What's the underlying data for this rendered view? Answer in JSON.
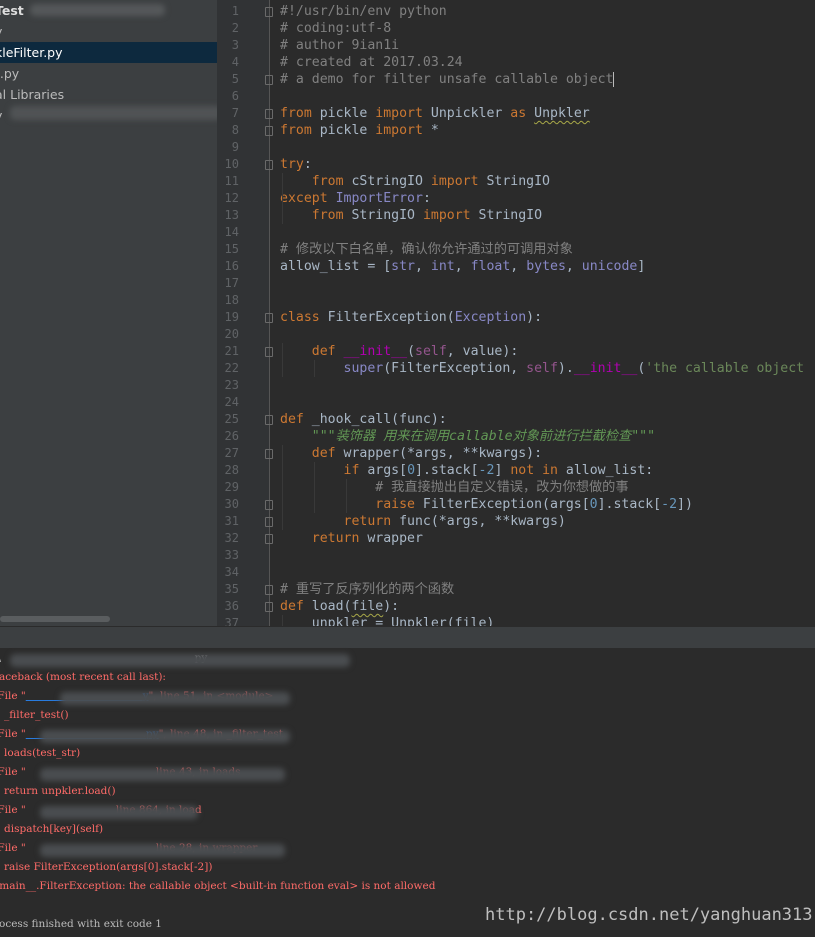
{
  "sidebar": {
    "items": [
      {
        "label": "Test",
        "selected": false,
        "bold": true
      },
      {
        "label": "y",
        "selected": false
      },
      {
        "label": "kleFilter.py",
        "selected": true
      },
      {
        "label": "t.py",
        "selected": false
      },
      {
        "label": "al Libraries",
        "selected": false
      },
      {
        "label": "y",
        "selected": false
      }
    ]
  },
  "editor": {
    "line_numbers": [
      "1",
      "2",
      "3",
      "4",
      "5",
      "6",
      "7",
      "8",
      "9",
      "10",
      "11",
      "12",
      "13",
      "14",
      "15",
      "16",
      "17",
      "18",
      "19",
      "20",
      "21",
      "22",
      "23",
      "24",
      "25",
      "26",
      "27",
      "28",
      "29",
      "30",
      "31",
      "32",
      "33",
      "34",
      "35",
      "36",
      "37"
    ],
    "lines": [
      [
        {
          "t": "#!/usr/bin/env python",
          "c": "cm"
        }
      ],
      [
        {
          "t": "# coding:utf-8",
          "c": "cm"
        }
      ],
      [
        {
          "t": "# author 9ian1i",
          "c": "cm"
        }
      ],
      [
        {
          "t": "# created at 2017.03.24",
          "c": "cm"
        }
      ],
      [
        {
          "t": "# a demo for filter unsafe callable object",
          "c": "cm"
        }
      ],
      [],
      [
        {
          "t": "from",
          "c": "kw"
        },
        {
          "t": " pickle "
        },
        {
          "t": "import",
          "c": "kw"
        },
        {
          "t": " Unpickler "
        },
        {
          "t": "as",
          "c": "kw"
        },
        {
          "t": " "
        },
        {
          "t": "Unpkler",
          "c": "wavy"
        }
      ],
      [
        {
          "t": "from",
          "c": "kw"
        },
        {
          "t": " pickle "
        },
        {
          "t": "import",
          "c": "kw"
        },
        {
          "t": " *"
        }
      ],
      [],
      [
        {
          "t": "try",
          "c": "kw"
        },
        {
          "t": ":"
        }
      ],
      [
        {
          "t": "    "
        },
        {
          "t": "from",
          "c": "kw"
        },
        {
          "t": " cStringIO "
        },
        {
          "t": "import",
          "c": "kw"
        },
        {
          "t": " StringIO"
        }
      ],
      [
        {
          "t": "except",
          "c": "kw"
        },
        {
          "t": " "
        },
        {
          "t": "ImportError",
          "c": "bi"
        },
        {
          "t": ":"
        }
      ],
      [
        {
          "t": "    "
        },
        {
          "t": "from",
          "c": "kw"
        },
        {
          "t": " StringIO "
        },
        {
          "t": "import",
          "c": "kw"
        },
        {
          "t": " StringIO"
        }
      ],
      [],
      [
        {
          "t": "# 修改以下白名单，确认你允许通过的可调用对象",
          "c": "cm"
        }
      ],
      [
        {
          "t": "allow_list = ["
        },
        {
          "t": "str",
          "c": "bi"
        },
        {
          "t": ", "
        },
        {
          "t": "int",
          "c": "bi"
        },
        {
          "t": ", "
        },
        {
          "t": "float",
          "c": "bi"
        },
        {
          "t": ", "
        },
        {
          "t": "bytes",
          "c": "bi"
        },
        {
          "t": ", "
        },
        {
          "t": "unicode",
          "c": "bi"
        },
        {
          "t": "]"
        }
      ],
      [],
      [],
      [
        {
          "t": "class",
          "c": "kw"
        },
        {
          "t": " FilterException("
        },
        {
          "t": "Exception",
          "c": "bi"
        },
        {
          "t": "):"
        }
      ],
      [],
      [
        {
          "t": "    "
        },
        {
          "t": "def",
          "c": "kw"
        },
        {
          "t": " "
        },
        {
          "t": "__init__",
          "c": "magic"
        },
        {
          "t": "("
        },
        {
          "t": "self",
          "c": "self"
        },
        {
          "t": ", value):"
        }
      ],
      [
        {
          "t": "        "
        },
        {
          "t": "super",
          "c": "bi"
        },
        {
          "t": "(FilterException, "
        },
        {
          "t": "self",
          "c": "self"
        },
        {
          "t": ")."
        },
        {
          "t": "__init__",
          "c": "magic"
        },
        {
          "t": "("
        },
        {
          "t": "'the callable object",
          "c": "str"
        }
      ],
      [],
      [],
      [
        {
          "t": "def",
          "c": "kw"
        },
        {
          "t": " _hook_call(func):"
        }
      ],
      [
        {
          "t": "    "
        },
        {
          "t": "\"\"\"装饰器 用来在调用callable对象前进行拦截检查\"\"\"",
          "c": "doc"
        }
      ],
      [
        {
          "t": "    "
        },
        {
          "t": "def",
          "c": "kw"
        },
        {
          "t": " wrapper(*args, **kwargs):"
        }
      ],
      [
        {
          "t": "        "
        },
        {
          "t": "if",
          "c": "kw"
        },
        {
          "t": " args["
        },
        {
          "t": "0",
          "c": "num"
        },
        {
          "t": "].stack["
        },
        {
          "t": "-2",
          "c": "num"
        },
        {
          "t": "] "
        },
        {
          "t": "not in",
          "c": "kw"
        },
        {
          "t": " allow_list:"
        }
      ],
      [
        {
          "t": "            "
        },
        {
          "t": "# 我直接抛出自定义错误，改为你想做的事",
          "c": "cm"
        }
      ],
      [
        {
          "t": "            "
        },
        {
          "t": "raise",
          "c": "kw"
        },
        {
          "t": " FilterException(args["
        },
        {
          "t": "0",
          "c": "num"
        },
        {
          "t": "].stack["
        },
        {
          "t": "-2",
          "c": "num"
        },
        {
          "t": "])"
        }
      ],
      [
        {
          "t": "        "
        },
        {
          "t": "return",
          "c": "kw"
        },
        {
          "t": " func(*args, **kwargs)"
        }
      ],
      [
        {
          "t": "    "
        },
        {
          "t": "return",
          "c": "kw"
        },
        {
          "t": " wrapper"
        }
      ],
      [],
      [],
      [
        {
          "t": "# 重写了反序列化的两个函数",
          "c": "cm"
        }
      ],
      [
        {
          "t": "def",
          "c": "kw"
        },
        {
          "t": " load("
        },
        {
          "t": "file",
          "c": "wavy"
        },
        {
          "t": "):"
        }
      ],
      [
        {
          "t": "    unpkler = Unpkler(file)"
        }
      ]
    ]
  },
  "console": {
    "lines": [
      [
        {
          "t": ":\\",
          "c": "plain"
        },
        {
          "t": "                                                          py",
          "c": "plain"
        }
      ],
      [
        {
          "t": "raceback (most recent call last):",
          "c": "err"
        }
      ],
      [
        {
          "t": " File \"",
          "c": "err"
        },
        {
          "t": "                                   ",
          "c": "lnk"
        },
        {
          "t": "y",
          "c": "lnk"
        },
        {
          "t": "\", line 51, in <module>",
          "c": "err"
        }
      ],
      [
        {
          "t": "   _filter_test()",
          "c": "err"
        }
      ],
      [
        {
          "t": " File \"",
          "c": "err"
        },
        {
          "t": "                                   ",
          "c": "lnk"
        },
        {
          "t": ".py",
          "c": "lnk"
        },
        {
          "t": "\", line 48, in _filter_test",
          "c": "err"
        }
      ],
      [
        {
          "t": "   loads(test_str)",
          "c": "err"
        }
      ],
      [
        {
          "t": " File \"",
          "c": "err"
        },
        {
          "t": "                                      ",
          "c": "plain"
        },
        {
          "t": " line 43, in loads",
          "c": "err"
        }
      ],
      [
        {
          "t": "   return unpkler.load()",
          "c": "err"
        }
      ],
      [
        {
          "t": " File \"",
          "c": "err"
        },
        {
          "t": "                          ",
          "c": "plain"
        },
        {
          "t": " line 864, in load",
          "c": "err"
        }
      ],
      [
        {
          "t": "   dispatch[key](self)",
          "c": "err"
        }
      ],
      [
        {
          "t": " File \"",
          "c": "err"
        },
        {
          "t": "                                      ",
          "c": "plain"
        },
        {
          "t": " line 28, in wrapper",
          "c": "err"
        }
      ],
      [
        {
          "t": "   raise FilterException(args[0].stack[-2])",
          "c": "err"
        }
      ],
      [
        {
          "t": "_main__.FilterException: the callable object <built-in function eval> is not allowed",
          "c": "err"
        }
      ],
      [],
      [
        {
          "t": "rocess finished with exit code 1",
          "c": "plain"
        }
      ]
    ]
  },
  "watermark": "http://blog.csdn.net/yanghuan313"
}
